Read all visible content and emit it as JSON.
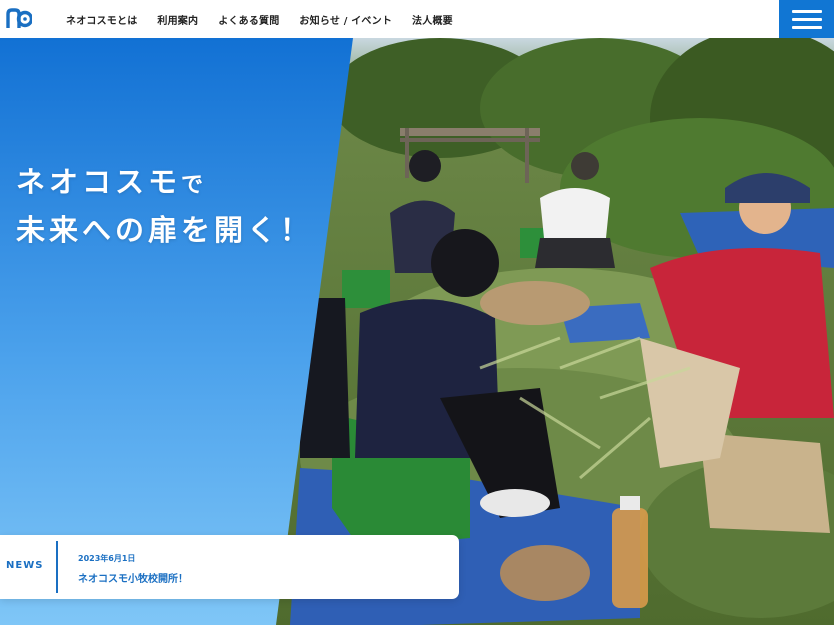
{
  "header": {
    "logo_icon": "neocosmo-logo-icon",
    "nav": [
      {
        "label": "ネオコスモとは"
      },
      {
        "label": "利用案内"
      },
      {
        "label": "よくある質問"
      },
      {
        "label": "お知らせ / イベント"
      },
      {
        "label": "法人概要"
      }
    ],
    "menu_icon": "hamburger-menu-icon"
  },
  "hero": {
    "catch_line1_main": "ネオコスモ",
    "catch_line1_suffix": "で",
    "catch_line2": "未来への扉を開く！",
    "photo": "people-sorting-garlic-harvest-in-field"
  },
  "news": {
    "label": "NEWS",
    "date": "2023年6月1日",
    "title": "ネオコスモ小牧校開所！"
  },
  "colors": {
    "brand_blue": "#1176d3",
    "panel_gradient_top": "#1271d4",
    "panel_gradient_bottom": "#7fc6f7",
    "text_dark": "#222222"
  }
}
